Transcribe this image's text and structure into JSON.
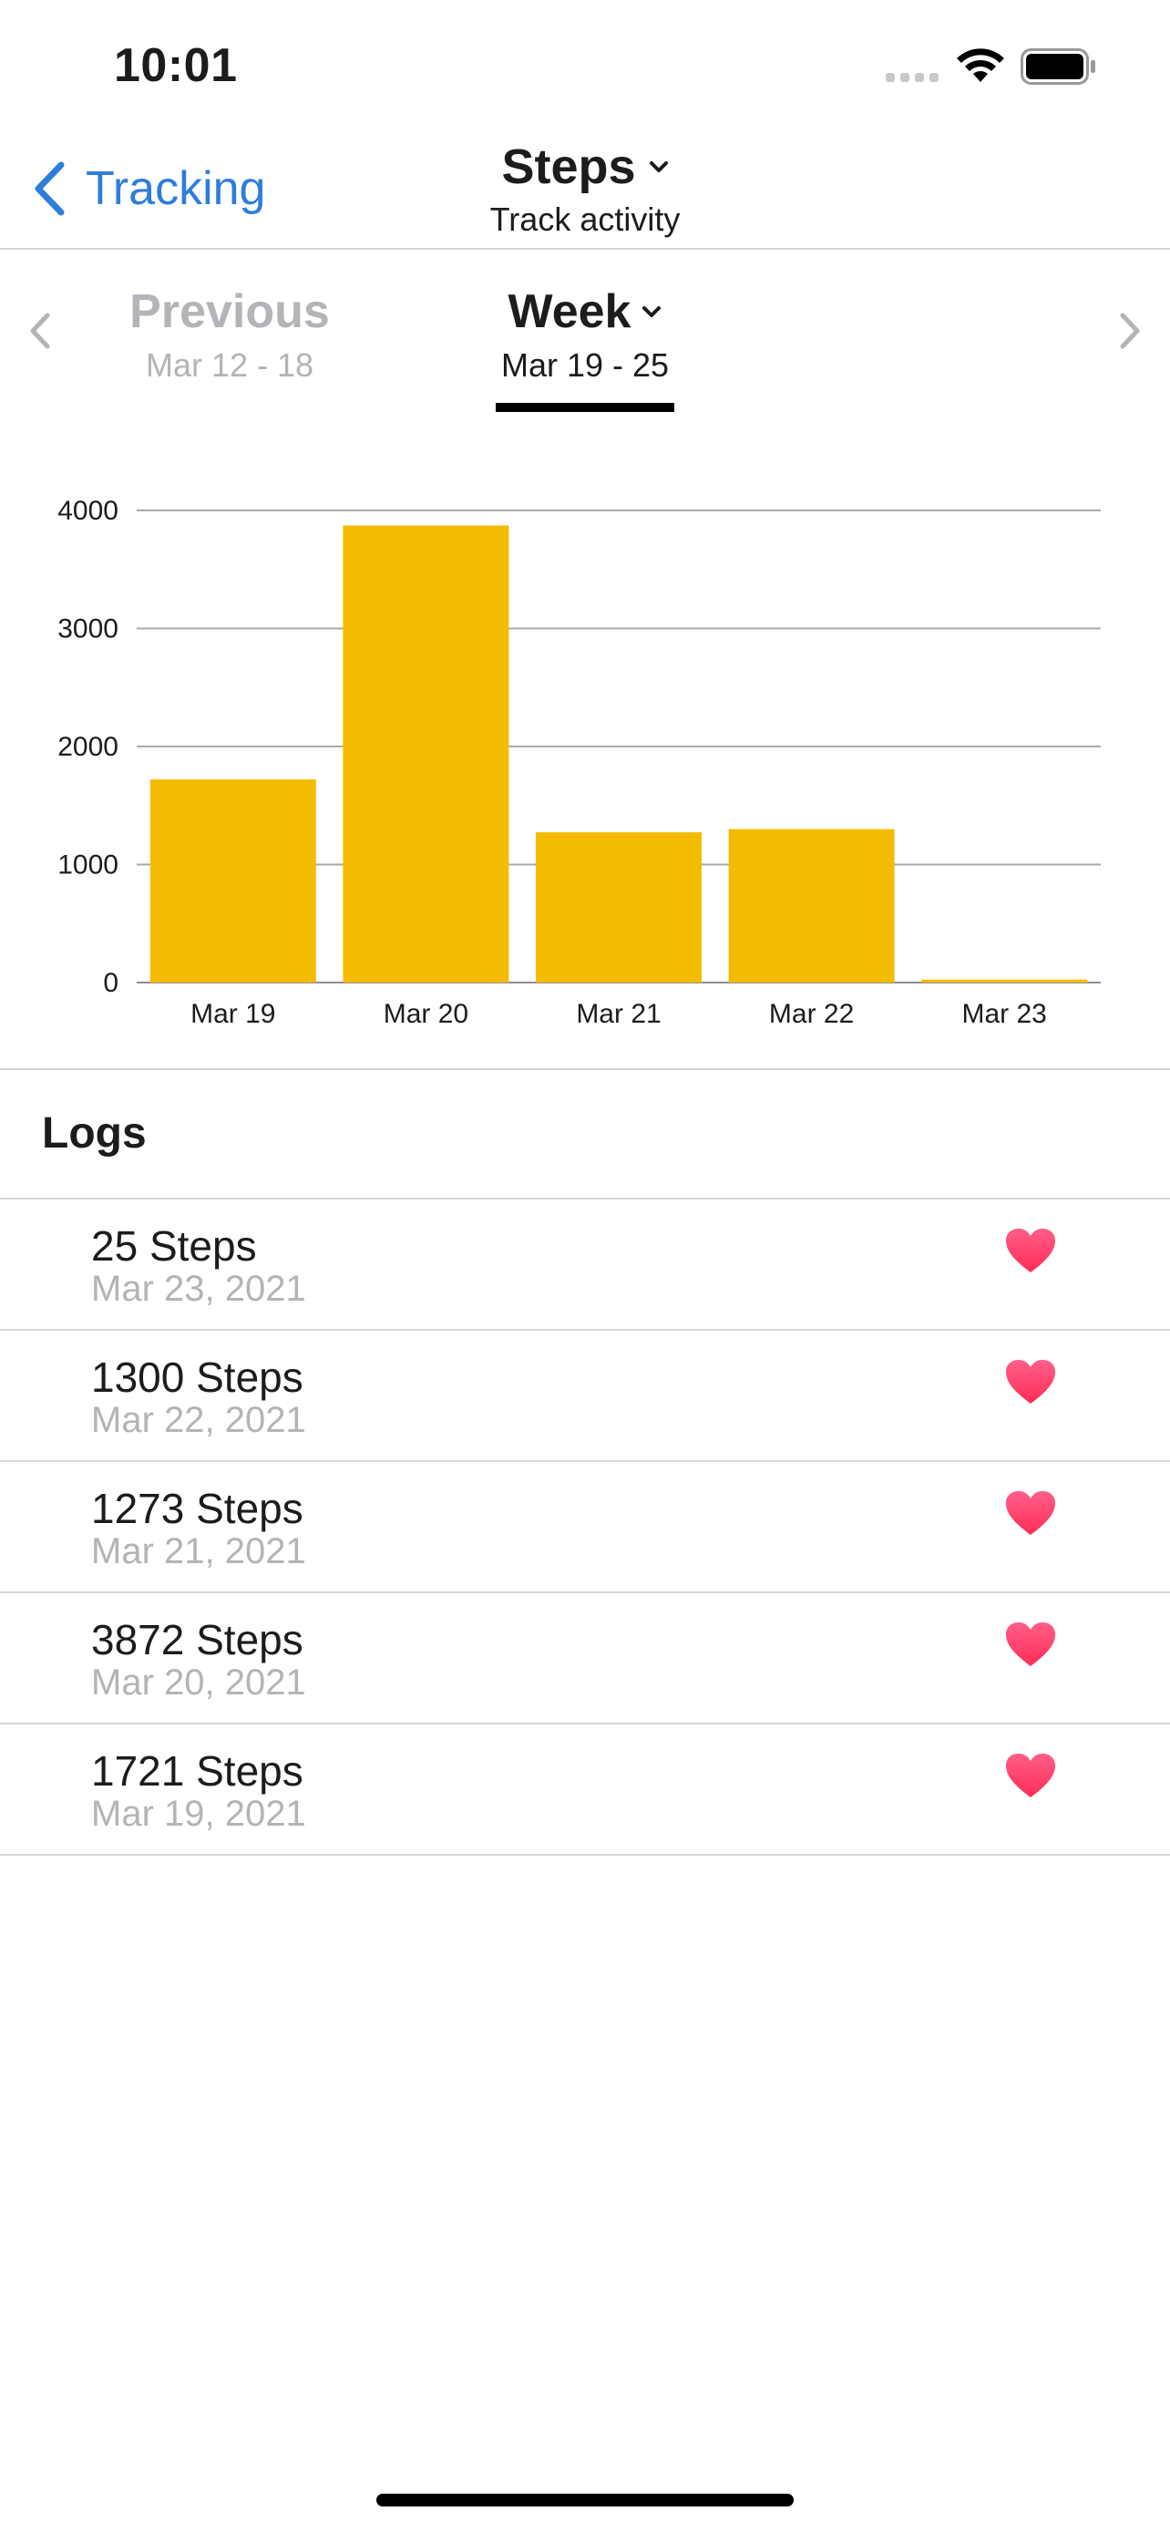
{
  "status_bar": {
    "time": "10:01"
  },
  "nav": {
    "back_label": "Tracking",
    "title": "Steps",
    "subtitle": "Track activity"
  },
  "period_selector": {
    "previous": {
      "label": "Previous",
      "range": "Mar 12 - 18"
    },
    "current": {
      "label": "Week",
      "range": "Mar 19 - 25"
    }
  },
  "chart_data": {
    "type": "bar",
    "categories": [
      "Mar 19",
      "Mar 20",
      "Mar 21",
      "Mar 22",
      "Mar 23"
    ],
    "values": [
      1721,
      3872,
      1273,
      1300,
      25
    ],
    "yticks": [
      0,
      1000,
      2000,
      3000,
      4000
    ],
    "ylim": [
      0,
      4000
    ],
    "grid": true,
    "color": "#f4bc00"
  },
  "logs": {
    "header": "Logs",
    "items": [
      {
        "steps": "25 Steps",
        "date": "Mar 23, 2021"
      },
      {
        "steps": "1300 Steps",
        "date": "Mar 22, 2021"
      },
      {
        "steps": "1273 Steps",
        "date": "Mar 21, 2021"
      },
      {
        "steps": "3872 Steps",
        "date": "Mar 20, 2021"
      },
      {
        "steps": "1721 Steps",
        "date": "Mar 19, 2021"
      }
    ]
  },
  "colors": {
    "accent": "#2f7ddb",
    "bar": "#f4bc00",
    "heart": "#ff2d55"
  },
  "icons": [
    "back-chevron-icon",
    "dropdown-chevron-icon",
    "left-arrow-icon",
    "right-arrow-icon",
    "wifi-icon",
    "battery-icon",
    "signal-icon",
    "heart-icon"
  ]
}
